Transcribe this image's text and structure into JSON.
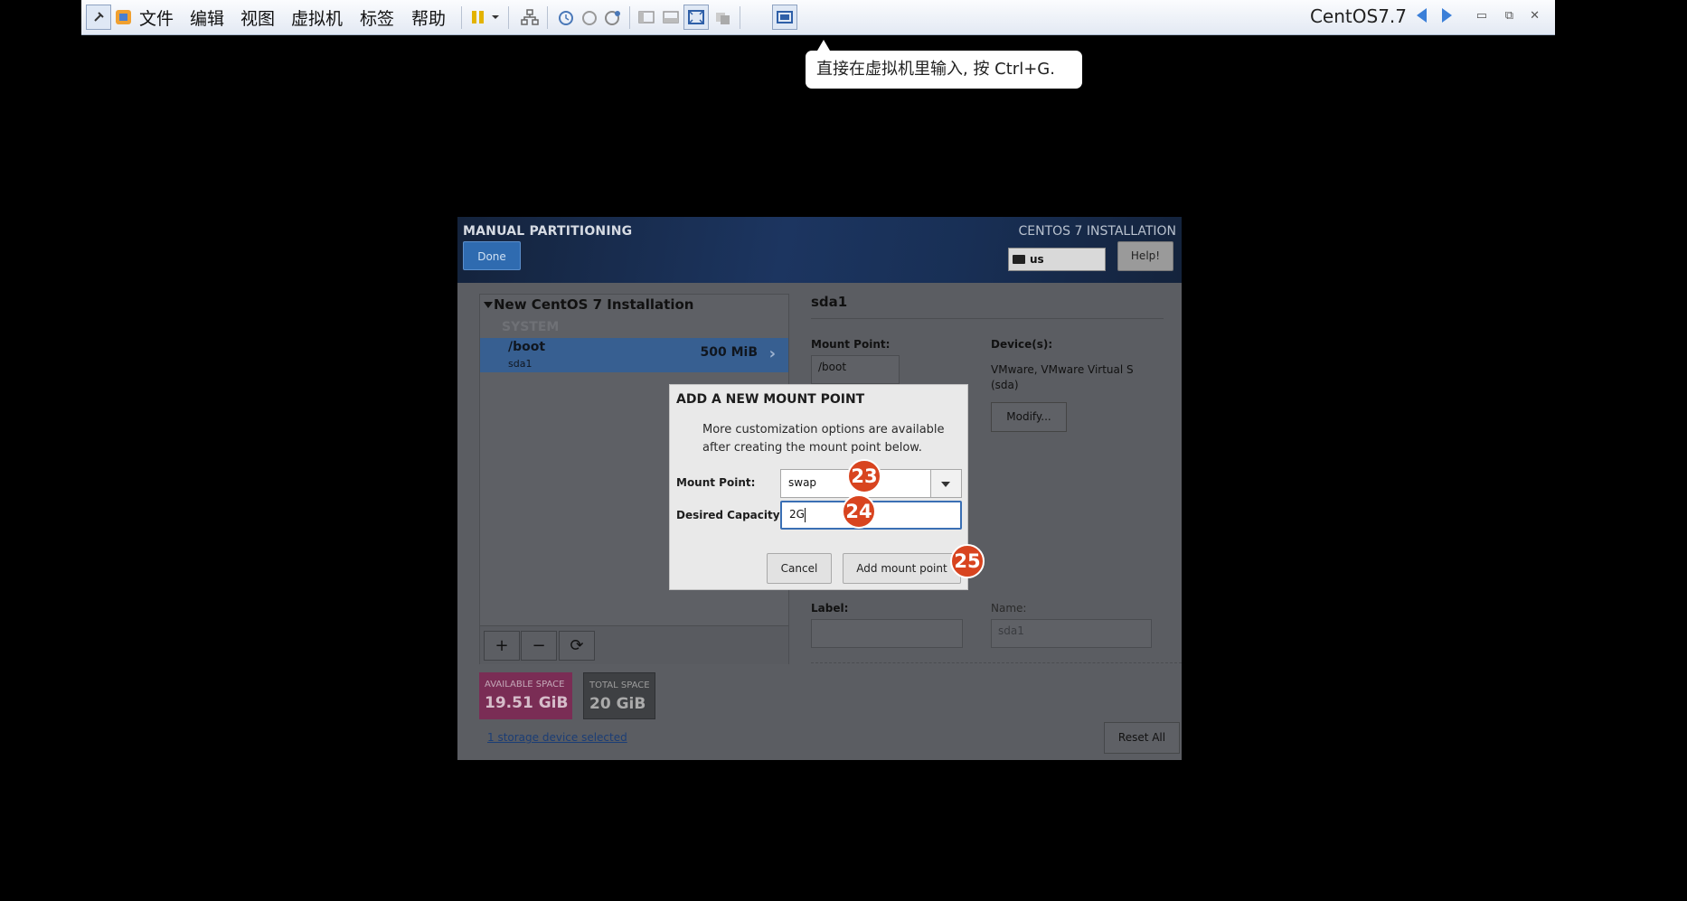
{
  "vmware": {
    "menu": [
      "文件",
      "编辑",
      "视图",
      "虚拟机",
      "标签",
      "帮助"
    ],
    "vm_name": "CentOS7.7",
    "tooltip": "直接在虚拟机里输入, 按 Ctrl+G."
  },
  "installer": {
    "header": {
      "title": "MANUAL PARTITIONING",
      "done_label": "Done",
      "product_title": "CENTOS 7 INSTALLATION",
      "keyboard_layout": "us",
      "help_label": "Help!"
    },
    "tree": {
      "title": "New CentOS 7 Installation",
      "section": "SYSTEM",
      "partitions": [
        {
          "mount": "/boot",
          "device": "sda1",
          "size": "500 MiB"
        }
      ],
      "add_symbol": "+",
      "remove_symbol": "−",
      "refresh_symbol": "⟳"
    },
    "space": {
      "available_label": "AVAILABLE SPACE",
      "available_value": "19.51 GiB",
      "total_label": "TOTAL SPACE",
      "total_value": "20 GiB"
    },
    "storage_link": "1 storage device selected",
    "reset_label": "Reset All",
    "details": {
      "title": "sda1",
      "mount_point_label": "Mount Point:",
      "mount_point_value": "/boot",
      "devices_label": "Device(s):",
      "devices_value": "VMware, VMware Virtual S (sda)",
      "modify_label": "Modify...",
      "label_label": "Label:",
      "label_value": "",
      "name_label": "Name:",
      "name_value": "sda1"
    },
    "dialog": {
      "title": "ADD A NEW MOUNT POINT",
      "description": "More customization options are available after creating the mount point below.",
      "mount_point_label": "Mount Point:",
      "mount_point_value": "swap",
      "capacity_label": "Desired Capacity:",
      "capacity_value": "2G",
      "cancel_label": "Cancel",
      "add_label": "Add mount point"
    }
  },
  "annotations": [
    "23",
    "24",
    "25"
  ],
  "colors": {
    "accent_blue": "#2f6bb0",
    "available_space": "#7a2d55",
    "badge": "#d8441f"
  }
}
